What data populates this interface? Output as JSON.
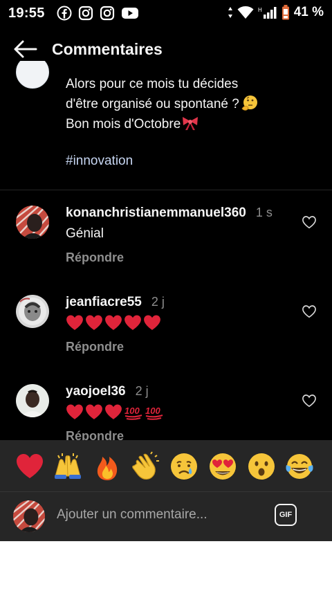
{
  "status_bar": {
    "time": "19:55",
    "battery": "41 %",
    "app_icons": [
      "facebook-icon",
      "instagram-icon",
      "instagram-icon",
      "youtube-icon"
    ]
  },
  "header": {
    "title": "Commentaires"
  },
  "caption": {
    "lines": [
      "Alors pour ce mois tu décides",
      "d'être organisé ou spontané ?",
      "Bon mois d'Octobre"
    ],
    "hashtag": "#innovation"
  },
  "comments": [
    {
      "username": "konanchristianemmanuel360",
      "time": "1 s",
      "text": "Génial",
      "reply_label": "Répondre"
    },
    {
      "username": "jeanfiacre55",
      "time": "2 j",
      "text": "",
      "reply_label": "Répondre"
    },
    {
      "username": "yaojoel36",
      "time": "2 j",
      "text": "",
      "reply_label": "Répondre"
    }
  ],
  "reactions": [
    "heart",
    "raising-hands",
    "fire",
    "clapping-hands",
    "crying-face",
    "heart-eyes-face",
    "surprised-face",
    "tears-of-joy-face"
  ],
  "comment_input": {
    "placeholder": "Ajouter un commentaire..."
  },
  "gif_button": {
    "label": "GIF"
  },
  "colors": {
    "background": "#000000",
    "panel": "#262626",
    "text": "#f5f5f5",
    "muted": "#8e8e8e",
    "hashtag": "#c7d6f2",
    "heart_red": "#e0243a"
  }
}
